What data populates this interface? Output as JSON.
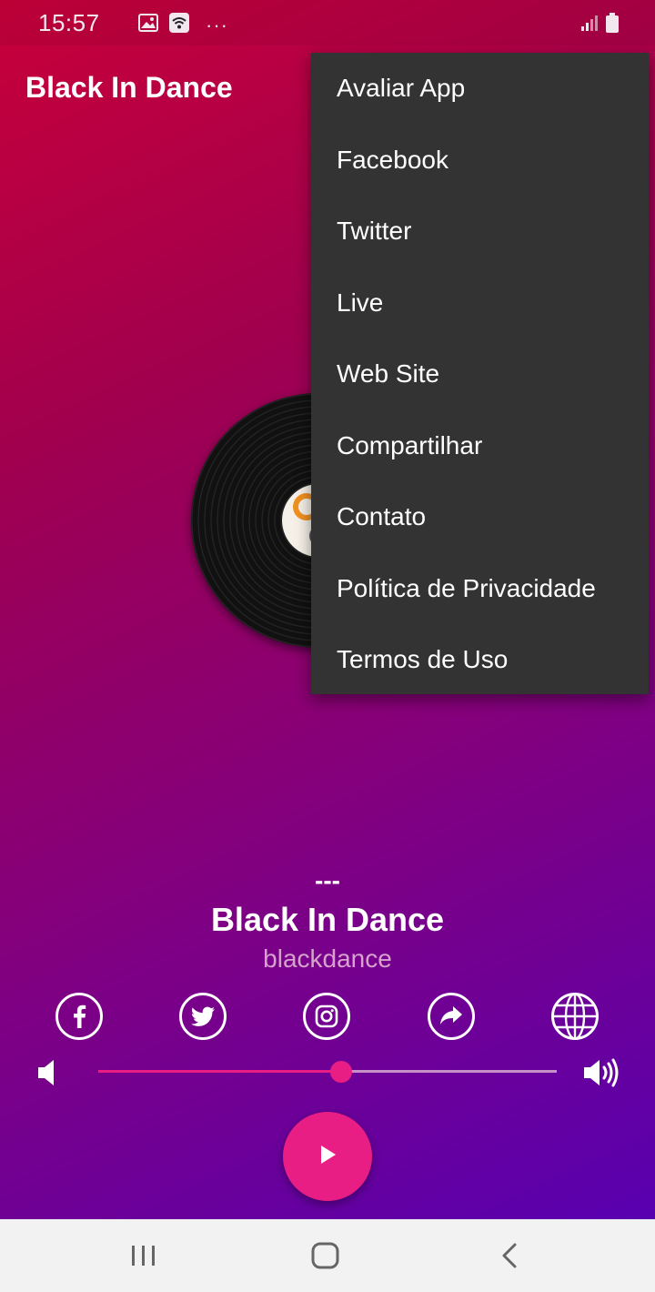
{
  "status_bar": {
    "time": "15:57",
    "dots": "···"
  },
  "app": {
    "title": "Black In Dance"
  },
  "menu": {
    "items": [
      {
        "label": "Avaliar App"
      },
      {
        "label": "Facebook"
      },
      {
        "label": "Twitter"
      },
      {
        "label": "Live"
      },
      {
        "label": "Web Site"
      },
      {
        "label": "Compartilhar"
      },
      {
        "label": "Contato"
      },
      {
        "label": "Política de Privacidade"
      },
      {
        "label": "Termos de Uso"
      }
    ]
  },
  "track": {
    "separator": "---",
    "title": "Black In Dance",
    "subtitle": "blackdance"
  },
  "social_icons": [
    "facebook-icon",
    "twitter-icon",
    "instagram-icon",
    "share-icon",
    "globe-icon"
  ],
  "volume": {
    "level": 0.53
  },
  "colors": {
    "accent": "#e91e84",
    "menu_bg": "#333333",
    "gradient_start": "#c8003a",
    "gradient_end": "#5800b0"
  }
}
